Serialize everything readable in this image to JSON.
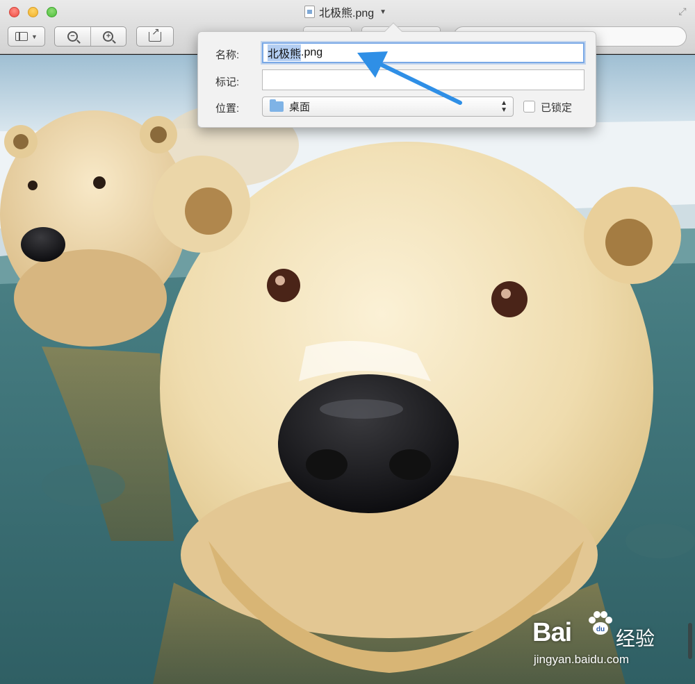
{
  "window": {
    "title": "北极熊.png",
    "title_menu_icon": "chevron-down-icon",
    "file_icon": "png-document-icon"
  },
  "toolbar": {
    "sidebar_button_icon": "sidebar-icon",
    "zoom_out_icon": "zoom-out-icon",
    "zoom_in_icon": "zoom-in-icon",
    "share_icon": "share-icon"
  },
  "rename_popover": {
    "name_label": "名称:",
    "name_value": ".png",
    "name_selected_part": "北极熊",
    "tags_label": "标记:",
    "tags_value": "",
    "location_label": "位置:",
    "location_value": "桌面",
    "locked_label": "已锁定",
    "locked_checked": false
  },
  "annotation": {
    "arrow_color": "#2f8fe6"
  },
  "watermark": {
    "brand": "Bai",
    "brand_suffix": "du",
    "product": "经验",
    "url": "jingyan.baidu.com"
  },
  "colors": {
    "selection": "#b4cef2",
    "focus_ring": "#79a8e6"
  }
}
